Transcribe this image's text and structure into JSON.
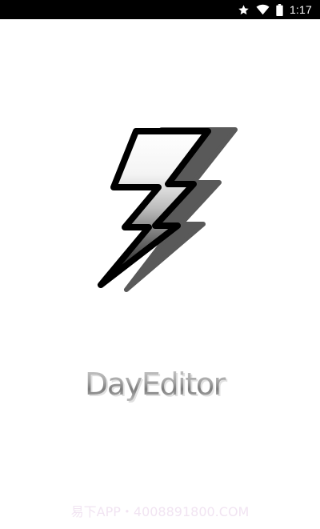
{
  "status_bar": {
    "time": "1:17",
    "icons": [
      "star-icon",
      "wifi-icon",
      "battery-icon"
    ]
  },
  "splash": {
    "logo_icon": "lightning-bolt-icon",
    "app_name": "DayEditor"
  },
  "watermark": {
    "text": "易下APP・4008891800.COM"
  },
  "colors": {
    "status_bar_bg": "#000000",
    "background": "#ffffff",
    "bolt_outline": "#000000",
    "bolt_shadow": "#555555",
    "watermark": "#f1e4f2"
  }
}
